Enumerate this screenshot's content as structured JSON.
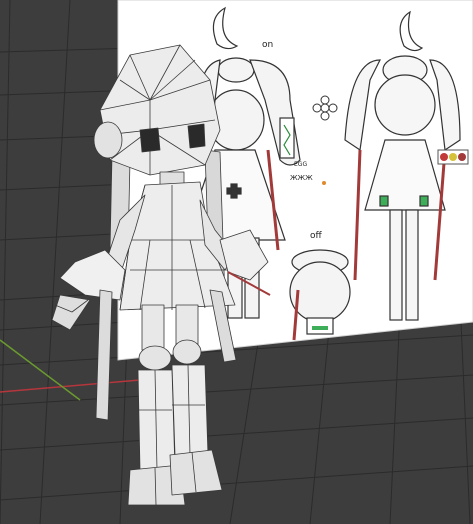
{
  "viewport": {
    "background": "#3d3d3d",
    "grid_color": "#2a2a2a",
    "x_axis_color": "#b5363c",
    "y_axis_color": "#6b9a2f"
  },
  "reference_sheet": {
    "label_on": "on",
    "label_off": "off",
    "label_egg": "EGG",
    "label_mark": "ЖЖЖ"
  },
  "model": {
    "face_color": "#e8e8e8",
    "wire_color": "#3a3a3a",
    "shadow_color": "#bdbdbd"
  }
}
